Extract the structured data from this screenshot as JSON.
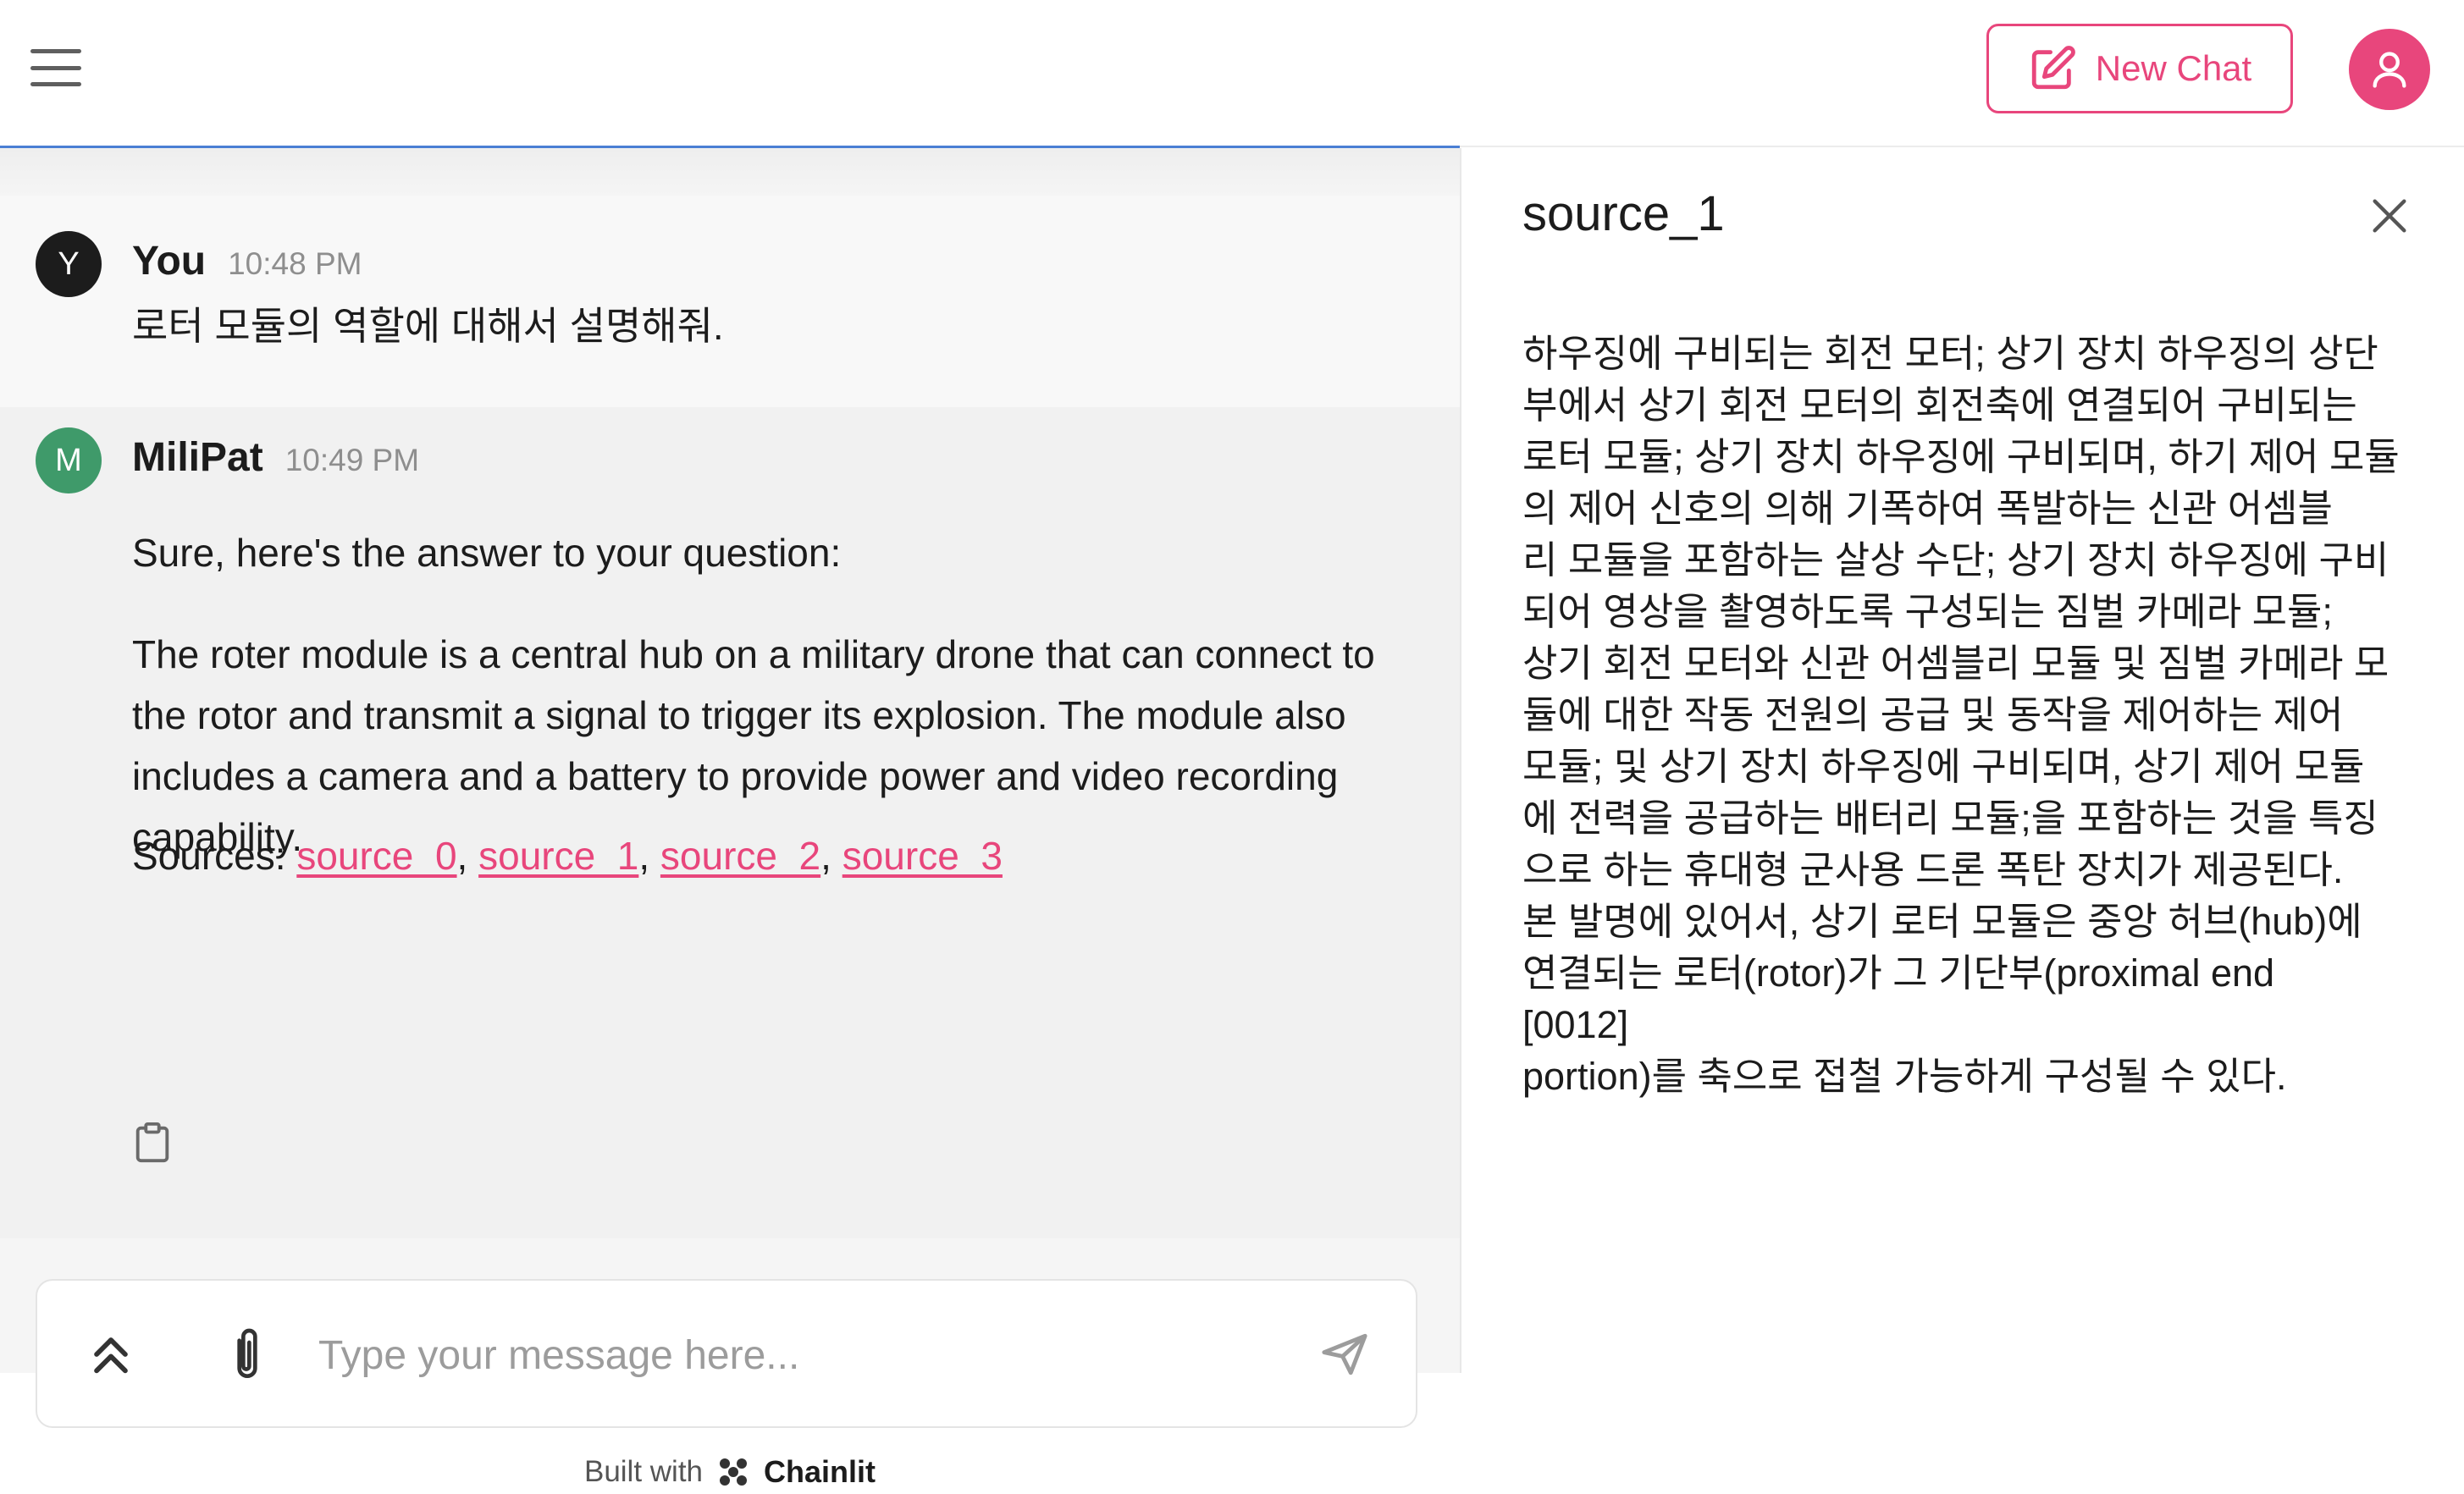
{
  "header": {
    "menu_icon": "hamburger-menu-icon",
    "new_chat_label": "New Chat",
    "new_chat_icon": "edit-square-icon",
    "user_icon": "user-icon"
  },
  "colors": {
    "accent": "#e8467c",
    "user_avatar": "#1c1c1c",
    "bot_avatar": "#3f9a6a",
    "progress": "#4a7fd4"
  },
  "messages": {
    "user": {
      "avatar_letter": "Y",
      "author": "You",
      "time": "10:48 PM",
      "text": "로터 모듈의 역할에 대해서 설명해줘."
    },
    "bot": {
      "avatar_letter": "M",
      "author": "MiliPat",
      "time": "10:49 PM",
      "line1": "Sure, here's the answer to your question:",
      "paragraph": "The roter module is a central hub on a military drone that can connect to the rotor and transmit a signal to trigger its explosion. The module also includes a camera and a battery to provide power and video recording capability.",
      "sources_label": "Sources: ",
      "sources": [
        "source_0",
        "source_1",
        "source_2",
        "source_3"
      ],
      "separator": ", ",
      "copy_icon": "clipboard-icon"
    }
  },
  "composer": {
    "placeholder": "Type your message here...",
    "expand_icon": "chevrons-up-icon",
    "attach_icon": "paperclip-icon",
    "send_icon": "send-icon"
  },
  "footer": {
    "built_with": "Built with",
    "brand": "Chainlit",
    "brand_icon": "chainlit-logo-icon"
  },
  "source_panel": {
    "title": "source_1",
    "close_icon": "close-icon",
    "body": "하우징에 구비되는 회전 모터; 상기 장치 하우징의 상단\n부에서 상기 회전 모터의 회전축에 연결되어 구비되는\n로터 모듈; 상기 장치 하우징에 구비되며, 하기 제어 모듈\n의 제어 신호의 의해 기폭하여 폭발하는 신관 어셈블\n리 모듈을 포함하는 살상 수단; 상기 장치 하우징에 구비\n되어 영상을 촬영하도록 구성되는 짐벌 카메라 모듈;\n상기 회전 모터와 신관 어셈블리 모듈 및 짐벌 카메라 모\n듈에 대한 작동 전원의 공급 및 동작을 제어하는 제어\n모듈; 및 상기 장치 하우징에 구비되며, 상기 제어 모듈\n에 전력을 공급하는 배터리 모듈;을 포함하는 것을 특징\n으로 하는 휴대형 군사용 드론 폭탄 장치가 제공된다.\n본 발명에 있어서, 상기 로터 모듈은 중앙 허브(hub)에\n연결되는 로터(rotor)가 그 기단부(proximal end\n[0012]\nportion)를 축으로 접철 가능하게 구성될 수 있다."
  }
}
